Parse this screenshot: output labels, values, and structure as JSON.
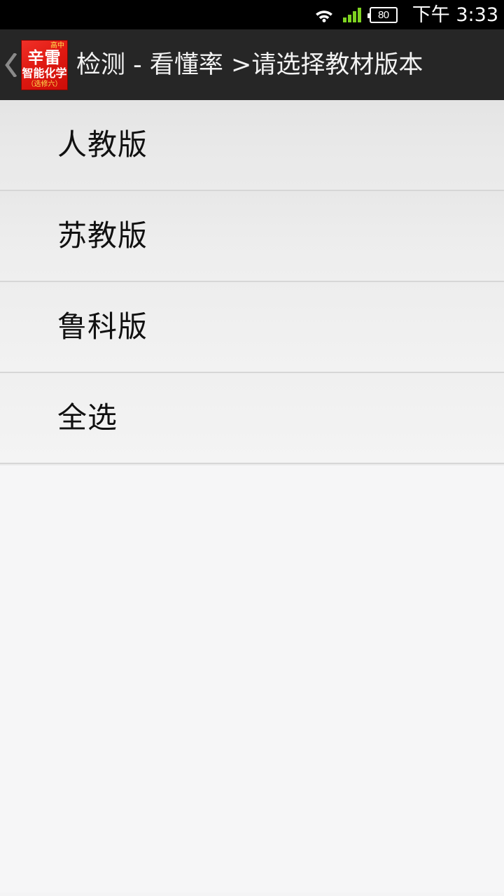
{
  "status_bar": {
    "wifi_icon": "wifi-icon",
    "signal_icon": "cellular-signal-icon",
    "battery_icon": "battery-icon",
    "battery_level": "80",
    "time": "下午 3:33"
  },
  "header": {
    "back_icon": "chevron-left-icon",
    "logo": {
      "top_text": "高中",
      "main_text": "辛雷",
      "sub_text": "智能化学",
      "note_text": "（选修六）",
      "background_color": "#e01a12",
      "accent_color": "#ffe14d"
    },
    "title": "检测 - 看懂率 >请选择教材版本"
  },
  "list": {
    "items": [
      {
        "label": "人教版"
      },
      {
        "label": "苏教版"
      },
      {
        "label": "鲁科版"
      },
      {
        "label": "全选"
      }
    ]
  },
  "colors": {
    "status_bar_bg": "#000000",
    "action_bar_bg": "#262626",
    "page_bg": "#f6f6f7",
    "divider": "#d6d6d6",
    "text_primary": "#111111"
  }
}
